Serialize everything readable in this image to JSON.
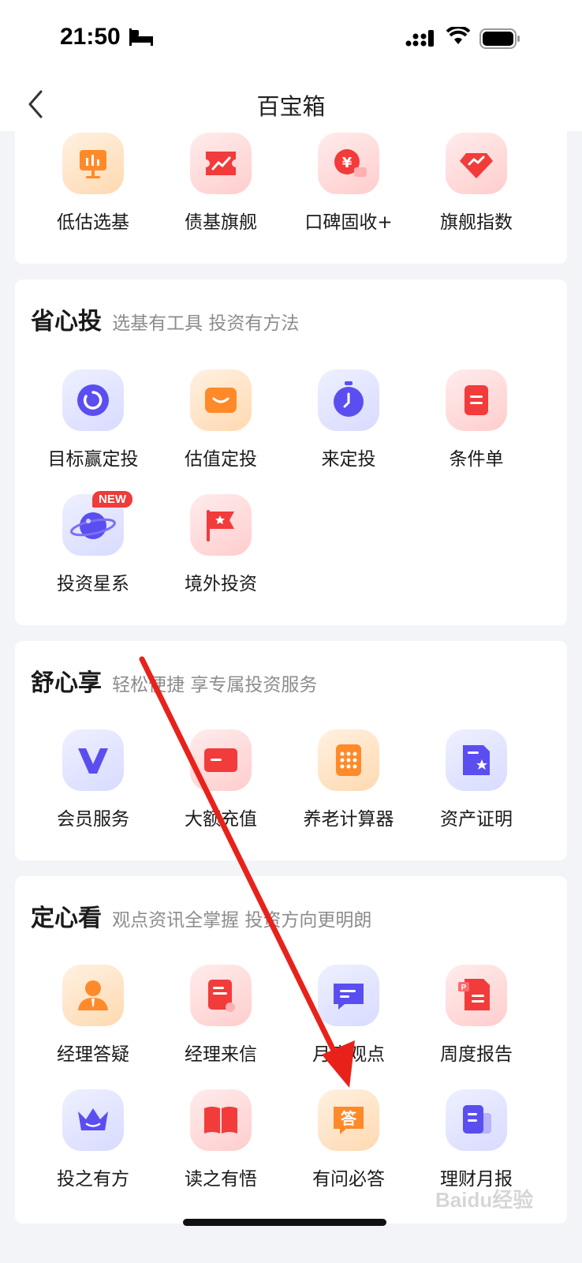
{
  "status_bar": {
    "time": "21:50"
  },
  "nav": {
    "title": "百宝箱"
  },
  "top_section": {
    "items": [
      {
        "label": "低估选基",
        "icon": "chart-board-icon"
      },
      {
        "label": "债基旗舰",
        "icon": "trend-ticket-icon"
      },
      {
        "label": "口碑固收+",
        "icon": "yuan-coin-icon"
      },
      {
        "label": "旗舰指数",
        "icon": "diamond-trend-icon"
      }
    ]
  },
  "sections": [
    {
      "title": "省心投",
      "subtitle": "选基有工具 投资有方法",
      "items": [
        {
          "label": "目标赢定投",
          "icon": "target-ring-icon"
        },
        {
          "label": "估值定投",
          "icon": "smile-box-icon"
        },
        {
          "label": "来定投",
          "icon": "stopwatch-icon"
        },
        {
          "label": "条件单",
          "icon": "order-doc-icon"
        },
        {
          "label": "投资星系",
          "icon": "planet-icon",
          "badge": "NEW"
        },
        {
          "label": "境外投资",
          "icon": "flag-icon"
        }
      ]
    },
    {
      "title": "舒心享",
      "subtitle": "轻松便捷 享专属投资服务",
      "items": [
        {
          "label": "会员服务",
          "icon": "vip-v-icon"
        },
        {
          "label": "大额充值",
          "icon": "card-icon"
        },
        {
          "label": "养老计算器",
          "icon": "calculator-icon"
        },
        {
          "label": "资产证明",
          "icon": "certificate-icon"
        }
      ]
    },
    {
      "title": "定心看",
      "subtitle": "观点资讯全掌握 投资方向更明朗",
      "items": [
        {
          "label": "经理答疑",
          "icon": "manager-icon"
        },
        {
          "label": "经理来信",
          "icon": "letter-icon"
        },
        {
          "label": "月度观点",
          "icon": "chat-bubble-icon"
        },
        {
          "label": "周度报告",
          "icon": "report-icon"
        },
        {
          "label": "投之有方",
          "icon": "crown-icon"
        },
        {
          "label": "读之有悟",
          "icon": "book-icon"
        },
        {
          "label": "有问必答",
          "icon": "answer-icon",
          "icon_text": "答"
        },
        {
          "label": "理财月报",
          "icon": "monthly-report-icon"
        }
      ]
    }
  ],
  "colors": {
    "orange": "#ff8a2a",
    "red": "#f23b3b",
    "purple": "#5b4ef0",
    "annotation_arrow": "#e8221b"
  },
  "watermark": "Baidu经验"
}
